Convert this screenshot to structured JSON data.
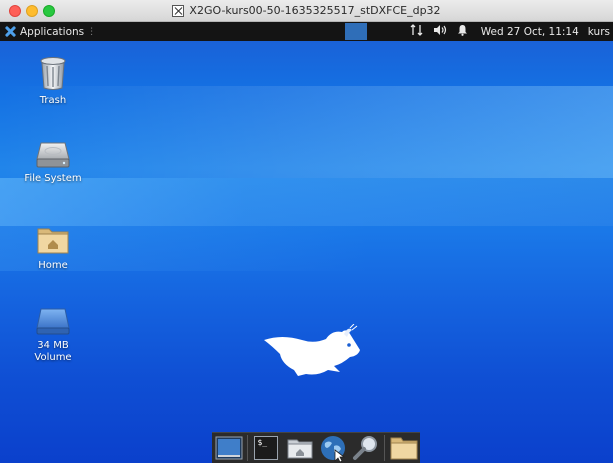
{
  "window": {
    "title": "X2GO-kurs00-50-1635325517_stDXFCE_dp32"
  },
  "panel": {
    "applications_label": "Applications",
    "applications_separator": "⋮",
    "tray": {
      "network_icon": "network-icon",
      "volume_icon": "volume-icon",
      "notification_icon": "bell-icon"
    },
    "clock": "Wed 27 Oct, 11:14",
    "user": "kurs"
  },
  "desktop": {
    "icons": [
      {
        "name": "trash",
        "label": "Trash",
        "icon": "trash-icon"
      },
      {
        "name": "file-system",
        "label": "File System",
        "icon": "hard-drive-icon"
      },
      {
        "name": "home",
        "label": "Home",
        "icon": "home-folder-icon"
      },
      {
        "name": "volume",
        "label": "34 MB Volume",
        "icon": "removable-drive-icon"
      }
    ],
    "wallpaper_logo": "xfce-mouse-logo"
  },
  "dock": {
    "items": [
      {
        "name": "show-desktop",
        "icon": "desktop-icon"
      },
      {
        "name": "terminal",
        "icon": "terminal-icon",
        "glyph": "$_"
      },
      {
        "name": "file-manager",
        "icon": "home-folder-icon"
      },
      {
        "name": "web-browser",
        "icon": "globe-icon"
      },
      {
        "name": "app-finder",
        "icon": "magnifier-icon"
      },
      {
        "name": "folder",
        "icon": "folder-icon"
      }
    ]
  },
  "colors": {
    "desktop_blue": "#1471e3",
    "panel_bg": "#141414",
    "accent": "#4ea0ea"
  }
}
